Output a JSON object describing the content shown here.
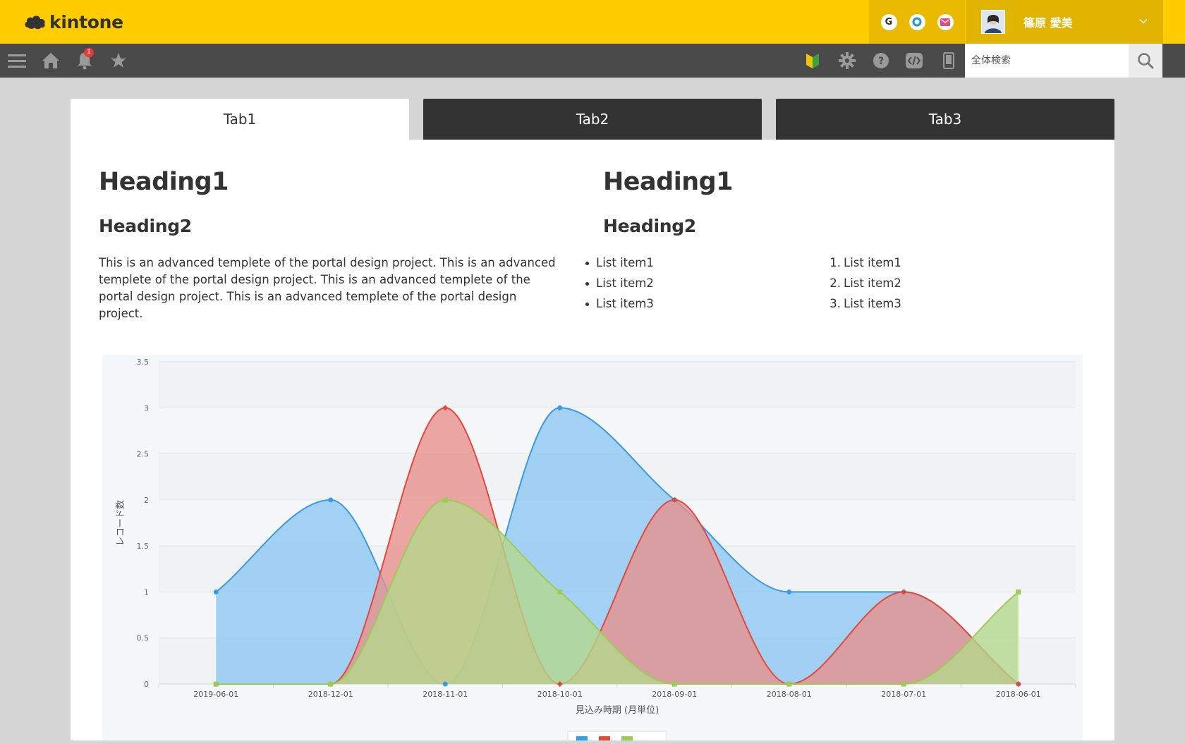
{
  "header": {
    "logo_text": "kintone",
    "user_name": "篠原 愛美",
    "apps": [
      {
        "name": "g-app-icon",
        "label": "G",
        "color": "#333333"
      },
      {
        "name": "o-app-icon",
        "label": "",
        "color": "#1a9ad6"
      },
      {
        "name": "mail-app-icon",
        "label": "",
        "color": "#e84a7a"
      }
    ]
  },
  "nav": {
    "notification_count": "1",
    "search_placeholder": "全体検索"
  },
  "tabs": [
    {
      "label": "Tab1",
      "active": true
    },
    {
      "label": "Tab2",
      "active": false
    },
    {
      "label": "Tab3",
      "active": false
    }
  ],
  "content": {
    "left": {
      "heading1": "Heading1",
      "heading2": "Heading2",
      "paragraph": "This is an advanced templete of the portal design project. This is an advanced templete of the portal design project. This is an advanced templete of the portal design project. This is an advanced templete of the portal design project."
    },
    "right": {
      "heading1": "Heading1",
      "heading2": "Heading2",
      "bullet_items": [
        "List item1",
        "List item2",
        "List item3"
      ],
      "numbered_items": [
        "List item1",
        "List item2",
        "List item3"
      ]
    }
  },
  "chart_data": {
    "type": "area",
    "xlabel": "見込み時期 (月単位)",
    "ylabel": "レコード数",
    "ylim": [
      0,
      3.5
    ],
    "yticks": [
      "0",
      "0.5",
      "1",
      "1.5",
      "2",
      "2.5",
      "3",
      "3.5"
    ],
    "categories": [
      "2019-06-01",
      "2018-12-01",
      "2018-11-01",
      "2018-10-01",
      "2018-09-01",
      "2018-08-01",
      "2018-07-01",
      "2018-06-01"
    ],
    "grid": true,
    "series": [
      {
        "color": "#3a9be5",
        "fill": "#8cc6f2",
        "marker": "circle",
        "values": [
          1,
          2,
          0,
          3,
          2,
          1,
          1,
          0
        ]
      },
      {
        "color": "#e5483b",
        "fill": "#e88f8a",
        "marker": "diamond",
        "values": [
          0,
          0,
          3,
          0,
          2,
          0,
          1,
          0
        ]
      },
      {
        "color": "#9ccc55",
        "fill": "#b3d98a",
        "marker": "square",
        "values": [
          0,
          0,
          2,
          1,
          0,
          0,
          0,
          1
        ]
      }
    ]
  }
}
